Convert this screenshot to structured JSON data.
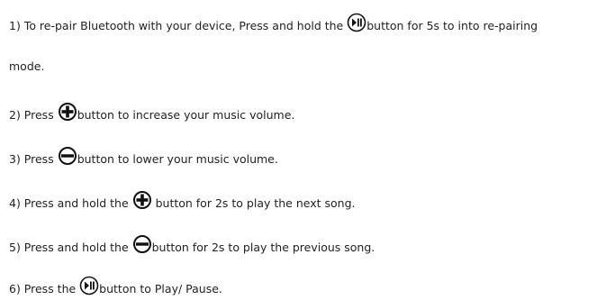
{
  "doc": {
    "items": [
      {
        "before": "1) To re-pair Bluetooth with your device, Press and hold the ",
        "icon": "play-pause-icon",
        "after": "button for 5s to into re-pairing"
      },
      {
        "before": "mode.",
        "icon": "",
        "after": ""
      },
      {
        "before": "2) Press ",
        "icon": "plus-icon",
        "after": "button to increase your music volume."
      },
      {
        "before": "3) Press ",
        "icon": "minus-icon",
        "after": "button to lower your music volume."
      },
      {
        "before": "4) Press and hold the ",
        "icon": "plus-icon",
        "after": " button for 2s to play the next song."
      },
      {
        "before": "5) Press and hold the ",
        "icon": "minus-icon",
        "after": "button for 2s to play the previous song."
      },
      {
        "before": "6) Press the ",
        "icon": "play-pause-icon",
        "after": "button to Play/ Pause."
      }
    ]
  },
  "colors": {
    "text": "#222222",
    "icon": "#111111"
  }
}
